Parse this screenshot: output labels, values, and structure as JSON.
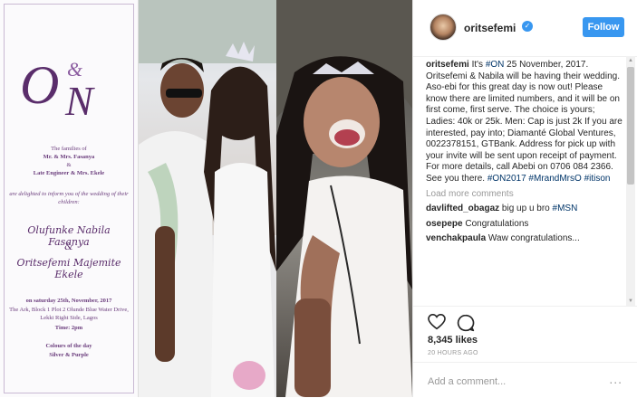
{
  "invitation": {
    "monogram": "O&N",
    "families_intro": "The families of",
    "family1": "Mr. & Mrs. Fasanya",
    "and": "&",
    "family2": "Late Engineer & Mrs. Ekele",
    "delighted": "are delighted to inform you of the wedding of their children:",
    "bride": "Olufunke Nabila Fasanya",
    "amp": "&",
    "groom": "Oritsefemi Majemite Ekele",
    "date": "on saturday 25th, November, 2017",
    "venue": "The Ark, Block 1 Plot 2 Olunde Blue Water Drive, Lekki Right Side, Lagos",
    "time": "Time: 2pm",
    "colours_title": "Colours of the day",
    "colours": "Silver & Purple"
  },
  "header": {
    "username": "oritsefemi",
    "verified_icon": "✓",
    "follow_label": "Follow"
  },
  "caption": {
    "username": "oritsefemi",
    "text_before": " It's ",
    "tag_on": "#ON",
    "text_main": " 25 November, 2017. Oritsefemi & Nabila will be having their wedding. Aso-ebi for this great day is now out! Please know there are limited numbers, and it will be on first come, first serve. The choice is yours; Ladies: 40k or 25k. Men: Cap is just 2k If you are interested, pay into; Diamanté Global Ventures, 0022378151, GTBank. Address for pick up with your invite will be sent upon receipt of payment. For more details, call Abebi on 0706 084 2366. See you there. ",
    "tag1": "#ON2017",
    "tag2": "#MrandMrsO",
    "tag3": "#itison"
  },
  "load_more": "Load more comments",
  "comments": [
    {
      "user": "davlifted_obagaz",
      "text": " big up u bro ",
      "tag": "#MSN"
    },
    {
      "user": "osepepe",
      "text": " Congratulations",
      "tag": ""
    },
    {
      "user": "venchakpaula",
      "text": " Waw congratulations...",
      "tag": ""
    }
  ],
  "actions": {
    "likes": "8,345 likes",
    "time": "20 HOURS AGO"
  },
  "add_comment": {
    "placeholder": "Add a comment...",
    "more": "..."
  }
}
